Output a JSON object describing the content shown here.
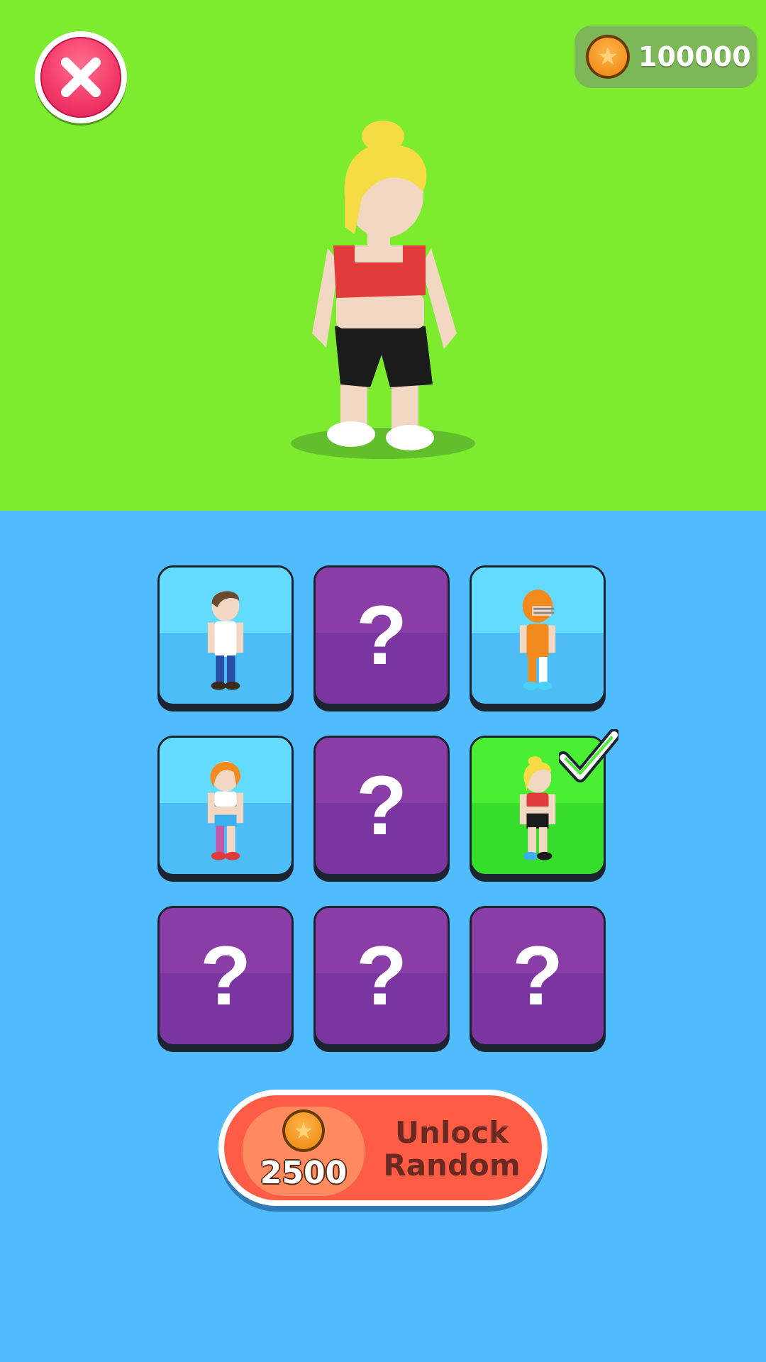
{
  "header": {
    "close_icon": "close-icon",
    "coins": "100000",
    "coin_icon": "coin-star-icon"
  },
  "preview": {
    "character": "blonde-girl-red-top",
    "hair_color": "#f5dc45",
    "top_color": "#e23b3b",
    "shorts_color": "#1a1a1a"
  },
  "grid": {
    "tiles": [
      {
        "state": "unlocked",
        "character": "brown-hair-boy"
      },
      {
        "state": "locked",
        "label": "?"
      },
      {
        "state": "unlocked",
        "character": "orange-football-player"
      },
      {
        "state": "unlocked",
        "character": "orange-hair-girl"
      },
      {
        "state": "locked",
        "label": "?"
      },
      {
        "state": "selected",
        "character": "blonde-girl-red-top"
      },
      {
        "state": "locked",
        "label": "?"
      },
      {
        "state": "locked",
        "label": "?"
      },
      {
        "state": "locked",
        "label": "?"
      }
    ]
  },
  "unlock": {
    "price": "2500",
    "label_line1": "Unlock",
    "label_line2": "Random"
  },
  "colors": {
    "top_bg": "#7deb2e",
    "bottom_bg": "#50bcfd",
    "locked_tile": "#7b35a0",
    "unlocked_tile": "#4dbdf5",
    "selected_tile": "#36dd2a",
    "unlock_button": "#ff5c46"
  }
}
